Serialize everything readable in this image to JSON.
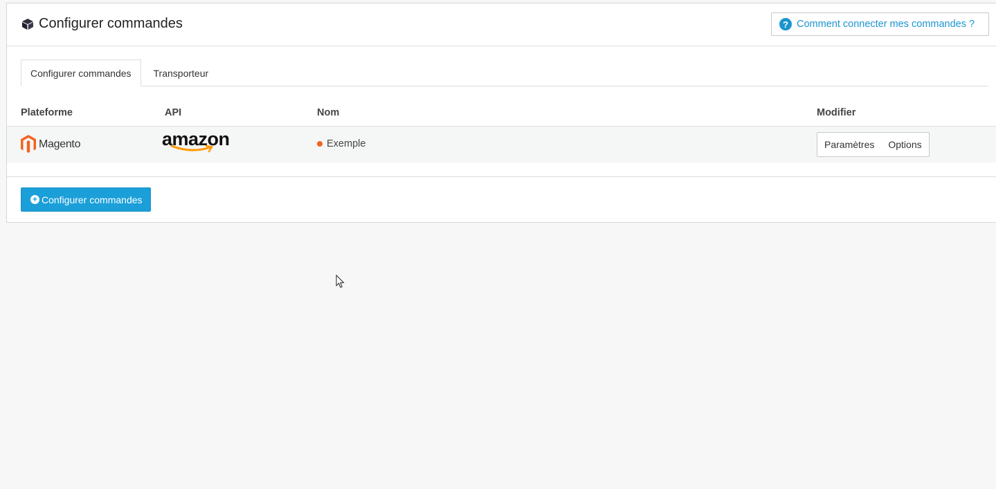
{
  "header": {
    "title": "Configurer commandes",
    "title_icon": "cube-icon",
    "help_label": "Comment connecter mes commandes ?"
  },
  "tabs": [
    {
      "label": "Configurer commandes",
      "active": true
    },
    {
      "label": "Transporteur",
      "active": false
    }
  ],
  "table": {
    "columns": [
      "Plateforme",
      "API",
      "Nom",
      "Modifier"
    ],
    "rows": [
      {
        "platform": "Magento",
        "api": "amazon",
        "name": "Exemple",
        "actions": [
          "Paramètres",
          "Options"
        ]
      }
    ]
  },
  "add_button_label": "Configurer commandes",
  "colors": {
    "accent": "#1b9fd9",
    "link": "#1b95cf",
    "status_dot": "#f26322",
    "magento_orange": "#f26322",
    "amazon_arrow": "#ff9900"
  }
}
